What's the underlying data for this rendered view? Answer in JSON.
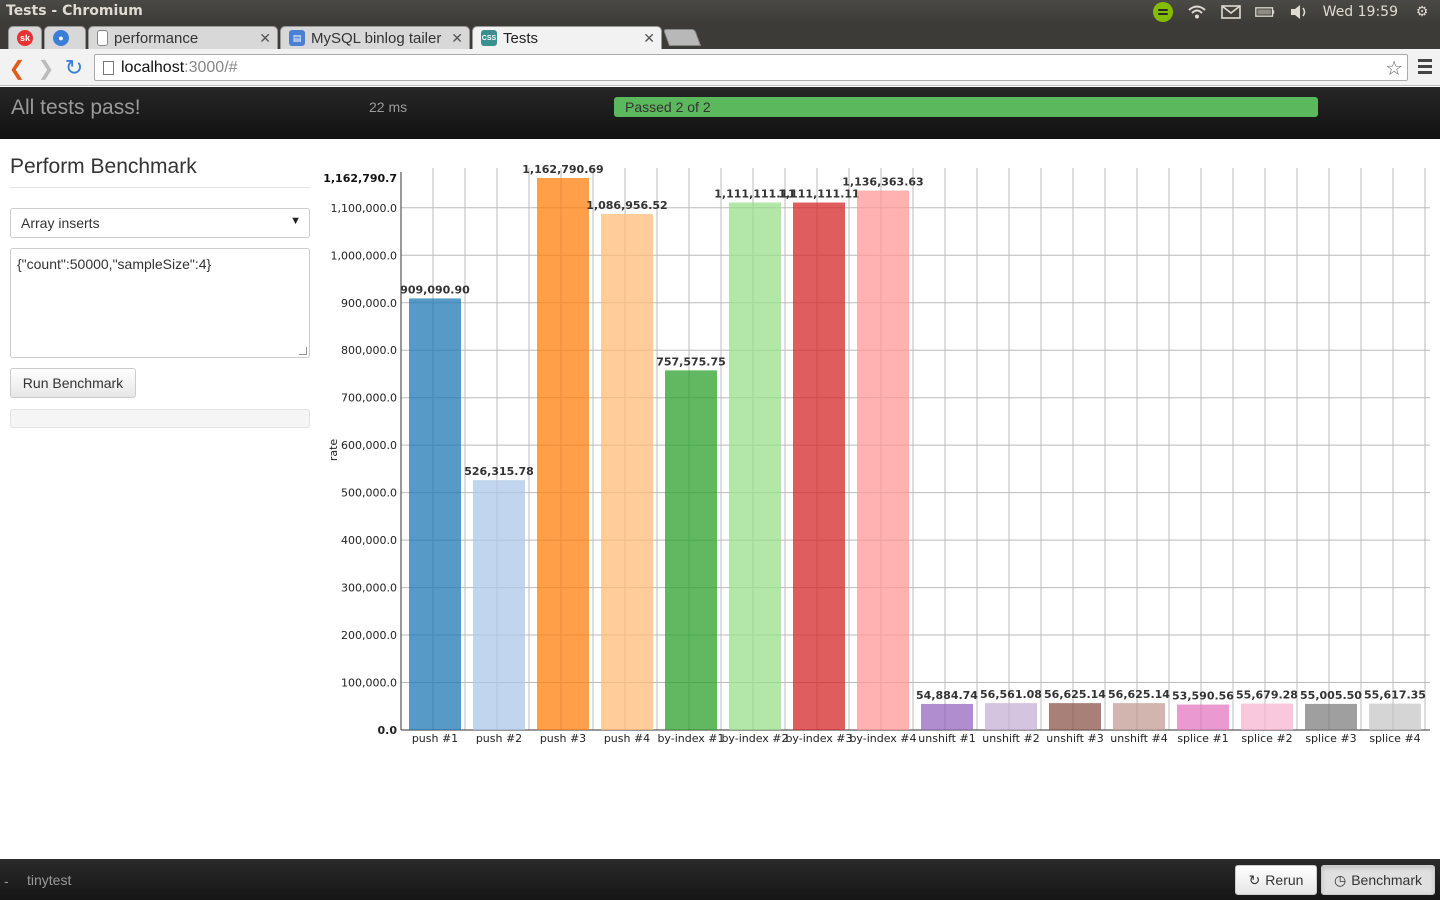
{
  "os": {
    "window_title": "Tests - Chromium",
    "clock": "Wed 19:59"
  },
  "browser": {
    "tabs": [
      {
        "label": "",
        "favicon": "sk-icon",
        "color": "#e8312f"
      },
      {
        "label": "",
        "favicon": "globe-icon",
        "color": "#3b7ed6"
      },
      {
        "label": "performance",
        "favicon": "document-icon"
      },
      {
        "label": "MySQL binlog tailer",
        "favicon": "doc-blue-icon"
      },
      {
        "label": "Tests",
        "favicon": "css-icon"
      }
    ],
    "url_host": "localhost",
    "url_rest": ":3000/#"
  },
  "header": {
    "status": "All tests pass!",
    "timing": "22 ms",
    "progress_label": "Passed 2 of 2",
    "progress_fraction": 1.0
  },
  "panel": {
    "title": "Perform Benchmark",
    "selected_benchmark": "Array inserts",
    "options_text": "{\"count\":50000,\"sampleSize\":4}",
    "run_label": "Run Benchmark"
  },
  "chart_data": {
    "type": "bar",
    "ylabel": "rate",
    "xlabel": "",
    "ylim": [
      0,
      1162790.7
    ],
    "yticks": [
      "0.0",
      "100,000.0",
      "200,000.0",
      "300,000.0",
      "400,000.0",
      "500,000.0",
      "600,000.0",
      "700,000.0",
      "800,000.0",
      "900,000.0",
      "1,000,000.0",
      "1,100,000.0"
    ],
    "ymax_label": "1,162,790.7",
    "grid": true,
    "categories": [
      "push #1",
      "push #2",
      "push #3",
      "push #4",
      "by-index #1",
      "by-index #2",
      "by-index #3",
      "by-index #4",
      "unshift #1",
      "unshift #2",
      "unshift #3",
      "unshift #4",
      "splice #1",
      "splice #2",
      "splice #3",
      "splice #4"
    ],
    "values": [
      909090.9,
      526315.78,
      1162790.69,
      1086956.52,
      757575.75,
      1111111.11,
      1111111.11,
      1136363.63,
      54884.74,
      56561.08,
      56625.14,
      56625.14,
      53590.56,
      55679.28,
      55005.5,
      55617.35
    ],
    "value_labels": [
      "909,090.90",
      "526,315.78",
      "1,162,790.69",
      "1,086,956.52",
      "757,575.75",
      "1,111,111.11",
      "1,111,111.11",
      "1,136,363.63",
      "54,884.74",
      "56,561.08",
      "56,625.14",
      "56,625.14",
      "53,590.56",
      "55,679.28",
      "55,005.50",
      "55,617.35"
    ],
    "colors": [
      "#1f77b4",
      "#aec7e8",
      "#ff7f0e",
      "#ffbb78",
      "#2ca02c",
      "#98df8a",
      "#d62728",
      "#ff9896",
      "#9467bd",
      "#c5b0d5",
      "#8c564b",
      "#c49c94",
      "#e377c2",
      "#f7b6d2",
      "#7f7f7f",
      "#c7c7c7"
    ]
  },
  "footer": {
    "dash": "-",
    "suite_name": "tinytest",
    "rerun_label": "Rerun",
    "benchmark_label": "Benchmark"
  }
}
